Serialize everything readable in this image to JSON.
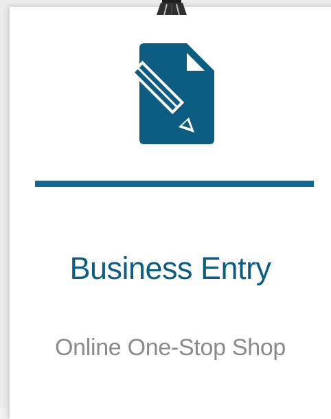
{
  "card": {
    "title": "Business Entry",
    "subtitle": "Online One-Stop Shop",
    "icon": "document-edit-icon",
    "clip_icon": "binder-clip-icon"
  },
  "colors": {
    "accent": "#0e6a93",
    "title": "#0d5d82",
    "subtitle": "#8a8a8a",
    "card_bg": "#ffffff",
    "page_bg": "#ececec"
  }
}
